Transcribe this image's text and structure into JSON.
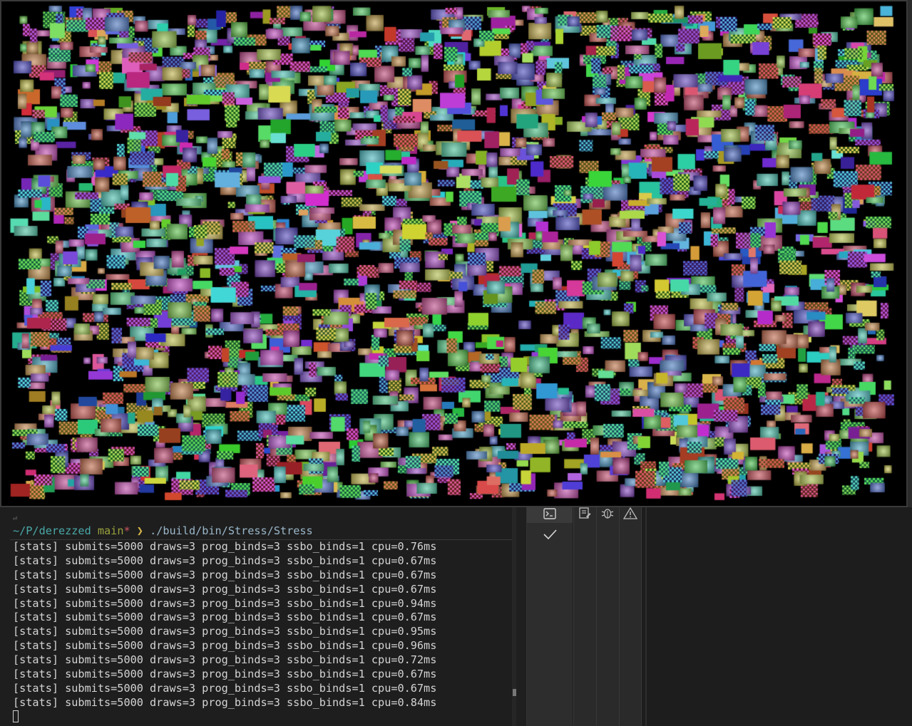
{
  "render_window": {
    "background": "#000000",
    "content": "stress test sprites"
  },
  "terminal": {
    "return_glyph": "⏎",
    "prompt": {
      "path": "~/P/derezzed",
      "branch": "main",
      "dirty_marker": "*",
      "arrow": "❯",
      "command": "./build/bin/Stress/Stress"
    },
    "stats_lines": [
      "[stats] submits=5000 draws=3 prog_binds=3 ssbo_binds=1 cpu=0.76ms",
      "[stats] submits=5000 draws=3 prog_binds=3 ssbo_binds=1 cpu=0.67ms",
      "[stats] submits=5000 draws=3 prog_binds=3 ssbo_binds=1 cpu=0.67ms",
      "[stats] submits=5000 draws=3 prog_binds=3 ssbo_binds=1 cpu=0.67ms",
      "[stats] submits=5000 draws=3 prog_binds=3 ssbo_binds=1 cpu=0.94ms",
      "[stats] submits=5000 draws=3 prog_binds=3 ssbo_binds=1 cpu=0.67ms",
      "[stats] submits=5000 draws=3 prog_binds=3 ssbo_binds=1 cpu=0.95ms",
      "[stats] submits=5000 draws=3 prog_binds=3 ssbo_binds=1 cpu=0.96ms",
      "[stats] submits=5000 draws=3 prog_binds=3 ssbo_binds=1 cpu=0.72ms",
      "[stats] submits=5000 draws=3 prog_binds=3 ssbo_binds=1 cpu=0.67ms",
      "[stats] submits=5000 draws=3 prog_binds=3 ssbo_binds=1 cpu=0.67ms",
      "[stats] submits=5000 draws=3 prog_binds=3 ssbo_binds=1 cpu=0.84ms"
    ]
  },
  "side_panel": {
    "icons": [
      "terminal-icon",
      "edit-icon",
      "bug-icon",
      "warning-icon",
      "check-icon"
    ]
  },
  "colors": {
    "terminal_bg": "#1e1e1e",
    "prompt_path": "#4aa8a8",
    "prompt_branch": "#9aa33e",
    "prompt_dirty": "#d0565f",
    "prompt_arrow": "#d9b94a",
    "prompt_command": "#9bb7c9"
  }
}
